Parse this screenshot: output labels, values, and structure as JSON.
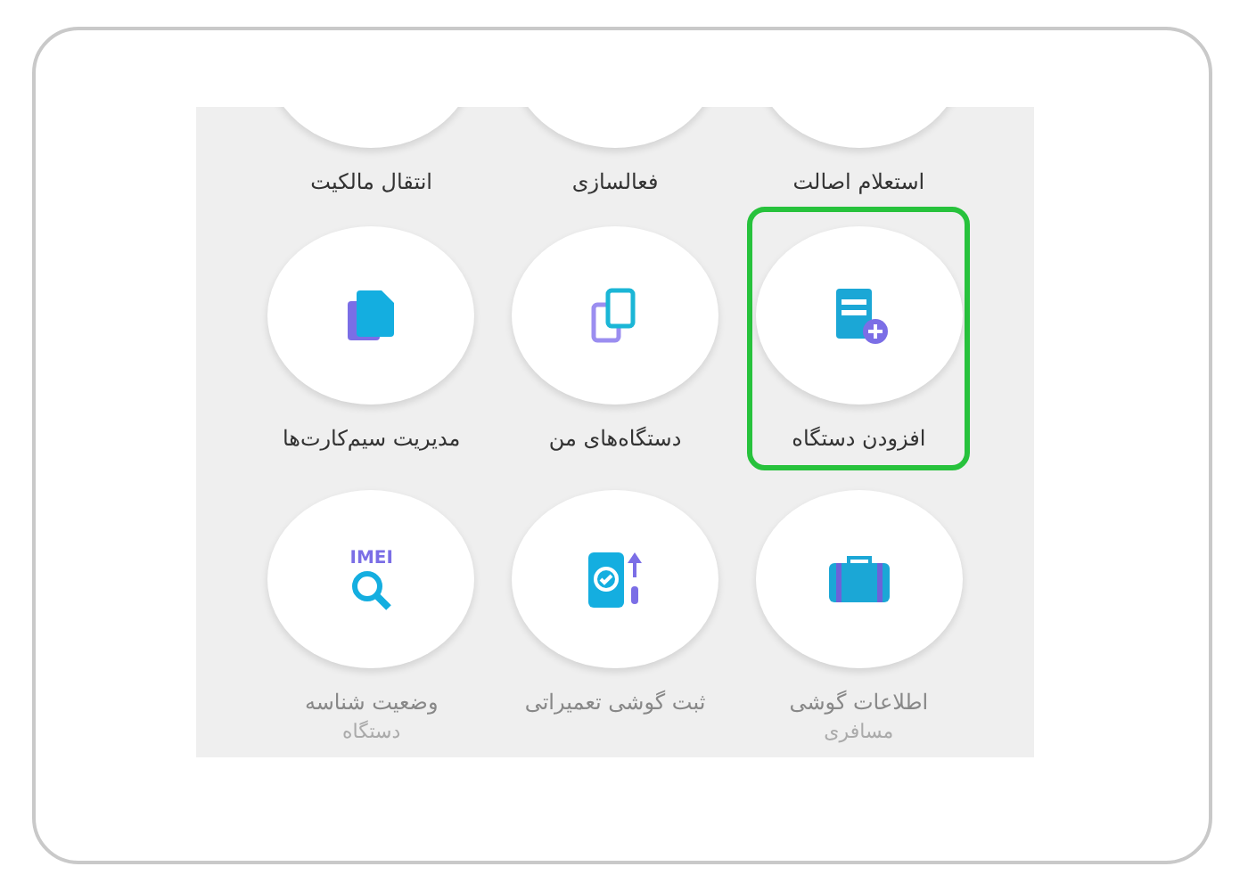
{
  "rows": [
    {
      "cut_off": true,
      "tiles": [
        {
          "label": [
            "استعلام اصالت"
          ],
          "disabled": false,
          "selected": false
        },
        {
          "label": [
            "فعالسازی"
          ],
          "disabled": false,
          "selected": false
        },
        {
          "label": [
            "انتقال مالکیت"
          ],
          "disabled": false,
          "selected": false
        }
      ]
    },
    {
      "cut_off": false,
      "tiles": [
        {
          "kind": "add",
          "label": [
            "افزودن دستگاه"
          ],
          "disabled": false,
          "selected": true
        },
        {
          "kind": "devices",
          "label": [
            "دستگاه‌های من"
          ],
          "disabled": false,
          "selected": false
        },
        {
          "kind": "sims",
          "label": [
            "مدیریت سیم‌کارت‌ها"
          ],
          "disabled": false,
          "selected": false
        }
      ]
    },
    {
      "cut_off": false,
      "tiles": [
        {
          "kind": "travel",
          "label": [
            "اطلاعات گوشی",
            "مسافری"
          ],
          "disabled": true,
          "selected": false
        },
        {
          "kind": "repair",
          "label": [
            "ثبت گوشی تعمیراتی"
          ],
          "disabled": true,
          "selected": false
        },
        {
          "kind": "status",
          "icon_text": "IMEI",
          "label": [
            "وضعیت شناسه",
            "دستگاه"
          ],
          "disabled": true,
          "selected": false
        }
      ]
    }
  ]
}
